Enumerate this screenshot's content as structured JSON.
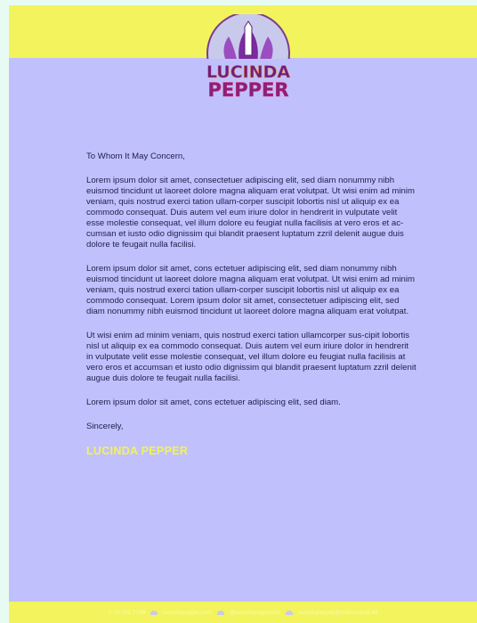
{
  "brand": {
    "logo_word_1": "LUCINDA",
    "logo_word_2": "PEPPER",
    "colors": {
      "yellow": "#f3f35d",
      "lavender": "#c0c0fd",
      "purple": "#6a1d8a",
      "orange": "#f08a24"
    }
  },
  "letter": {
    "salutation": "To Whom It May Concern,",
    "paragraphs": [
      "Lorem ipsum dolor sit amet, consectetuer adipiscing elit, sed diam nonummy nibh euismod tincidunt ut laoreet dolore magna aliquam erat volutpat. Ut wisi enim ad minim veniam, quis nostrud exerci tation ullam-corper suscipit lobortis nisl ut aliquip ex ea commodo consequat. Duis autem vel eum iriure dolor in hendrerit in vulputate velit esse molestie consequat, vel illum dolore eu feugiat nulla facilisis at vero eros et ac-cumsan et iusto odio dignissim qui blandit praesent luptatum zzril delenit augue duis dolore te feugait nulla facilisi.",
      "Lorem ipsum dolor sit amet, cons ectetuer adipiscing elit, sed diam nonummy nibh euismod tincidunt ut laoreet dolore magna aliquam erat volutpat. Ut wisi enim ad minim veniam, quis nostrud exerci tation ullam-corper suscipit lobortis nisl ut aliquip ex ea commodo consequat. Lorem ipsum dolor sit amet, consectetuer adipiscing elit, sed diam nonummy nibh euismod tincidunt ut laoreet dolore magna aliquam erat volutpat.",
      "Ut wisi enim ad minim veniam, quis nostrud exerci tation ullamcorper sus-cipit lobortis nisl ut aliquip ex ea commodo consequat. Duis autem vel eum iriure dolor in hendrerit in vulputate velit esse molestie consequat, vel illum dolore eu feugiat nulla facilisis at vero eros et accumsan et iusto odio dignissim qui blandit praesent luptatum zzril delenit augue duis dolore te feugait nulla facilisi.",
      "Lorem ipsum dolor sit amet, cons ectetuer adipiscing elit, sed diam."
    ],
    "closing": "Sincerely,",
    "signature": "LUCINDA PEPPER"
  },
  "footer": {
    "phone": "+ 00 242 7788",
    "website": "lucindapepper.com",
    "social": "@lucindapepperofic",
    "email": "lucindapepper@onlinecloud.tld"
  }
}
